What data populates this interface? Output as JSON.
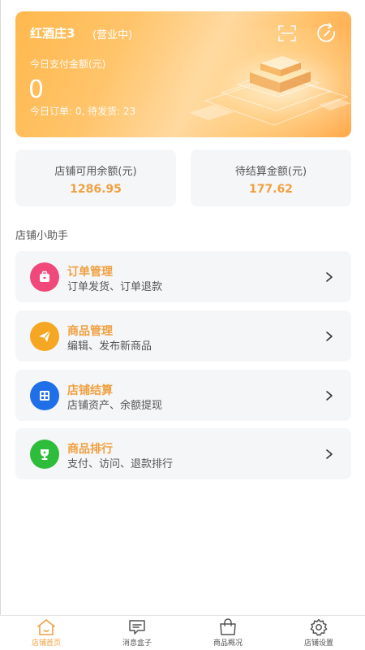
{
  "banner": {
    "store_name": "红酒庄3",
    "status": "(营业中)",
    "today_label": "今日支付金额(元)",
    "today_value": "0",
    "today_meta": "今日订单: 0,   待发货: 23",
    "scan_icon": "scan-icon",
    "refresh_icon": "refresh-icon"
  },
  "stats": [
    {
      "label": "店铺可用余额(元)",
      "value": "1286.95"
    },
    {
      "label": "待结算金额(元)",
      "value": "177.62"
    }
  ],
  "section_title": "店铺小助手",
  "menu": [
    {
      "title": "订单管理",
      "subtitle": "订单发货、订单退款",
      "icon": "briefcase-icon",
      "color": "#f0487a"
    },
    {
      "title": "商品管理",
      "subtitle": "编辑、发布新商品",
      "icon": "paper-plane-icon",
      "color": "#f5a623"
    },
    {
      "title": "店铺结算",
      "subtitle": "店铺资产、余额提现",
      "icon": "calculator-icon",
      "color": "#1e6fe8"
    },
    {
      "title": "商品排行",
      "subtitle": "支付、访问、退款排行",
      "icon": "trophy-icon",
      "color": "#2dbd3a"
    }
  ],
  "tabs": [
    {
      "label": "店铺首页",
      "icon": "home-icon",
      "active": true
    },
    {
      "label": "消息盒子",
      "icon": "message-icon",
      "active": false
    },
    {
      "label": "商品概况",
      "icon": "shopping-bag-icon",
      "active": false
    },
    {
      "label": "店铺设置",
      "icon": "settings-gear-icon",
      "active": false
    }
  ],
  "colors": {
    "accent": "#f0a040",
    "banner_start": "#ffb84d",
    "banner_end": "#ff9f3a"
  }
}
